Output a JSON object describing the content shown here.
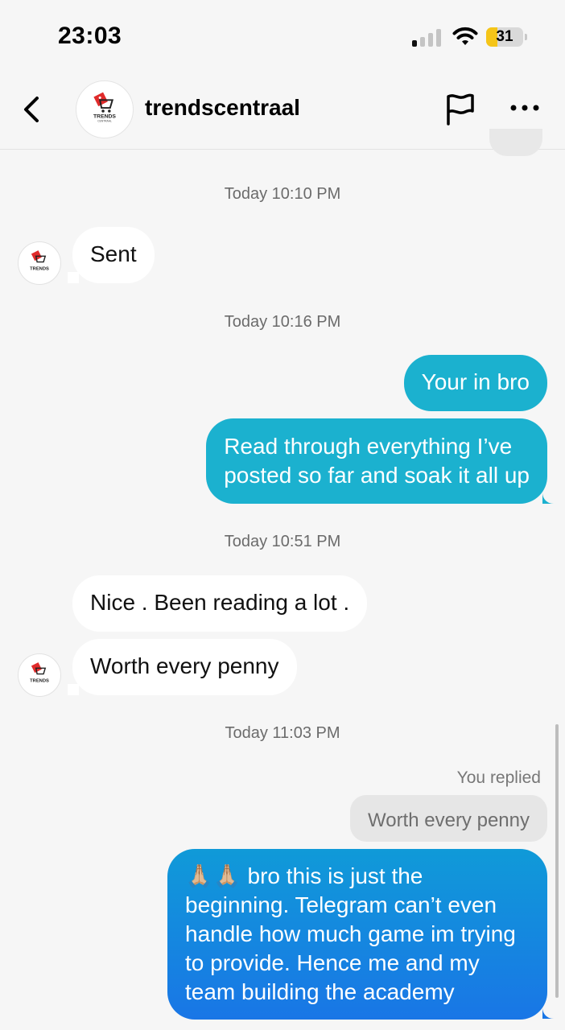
{
  "status_bar": {
    "time": "23:03",
    "battery_level": "31",
    "battery_fraction": 0.31,
    "signal_bars_active": 1,
    "signal_bars_total": 4
  },
  "header": {
    "contact_name": "trendscentraal",
    "avatar_logo_text": "TRENDS CENTRAAL",
    "back_icon": "chevron-left-icon",
    "flag_icon": "flag-icon",
    "more_icon": "more-horizontal-icon"
  },
  "messages": {
    "t1": "Today 10:10 PM",
    "m1": "Sent",
    "t2": "Today 10:16 PM",
    "m2": "Your in bro",
    "m3_line1": "Read through everything I’ve",
    "m3_line2": "posted so far and soak it all up",
    "t3": "Today 10:51 PM",
    "m4": "Nice . Been reading a lot .",
    "m5": "Worth every penny",
    "t4": "Today 11:03 PM",
    "reply_label": "You replied",
    "reply_preview": "Worth every penny",
    "m6_line1": "🙏🏼🙏🏼 bro this is just the",
    "m6_line2": "beginning. Telegram can’t even",
    "m6_line3": "handle how much game im trying",
    "m6_line4": "to provide. Hence me and my",
    "m6_line5": "team building the academy"
  },
  "colors": {
    "background": "#f6f6f6",
    "incoming_bubble": "#ffffff",
    "outgoing_bubble": "#1bb1cf",
    "outgoing_gradient_top": "#109ad8",
    "outgoing_gradient_bottom": "#1976e6",
    "battery": "#f5c518",
    "logo_red": "#e02b2b"
  }
}
